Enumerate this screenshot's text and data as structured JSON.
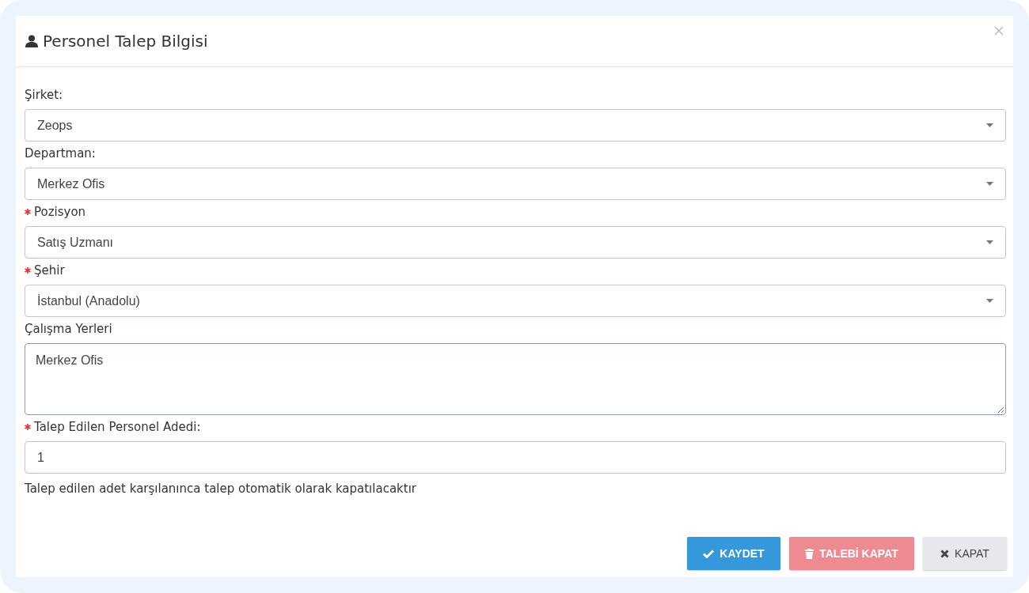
{
  "dialog": {
    "title": "Personel Talep Bilgisi"
  },
  "fields": [
    {
      "kind": "select",
      "label": "Şirket:",
      "required": false,
      "value": "Zeops"
    },
    {
      "kind": "select",
      "label": "Departman:",
      "required": false,
      "value": "Merkez Ofis"
    },
    {
      "kind": "select",
      "label": "Pozisyon",
      "required": true,
      "value": "Satış Uzmanı"
    },
    {
      "kind": "select",
      "label": "Şehir",
      "required": true,
      "value": "İstanbul (Anadolu)"
    },
    {
      "kind": "textarea",
      "label": "Çalışma Yerleri",
      "required": false,
      "value": "Merkez Ofis"
    },
    {
      "kind": "input",
      "label": "Talep Edilen Personel Adedi:",
      "required": true,
      "value": "1"
    }
  ],
  "note": "Talep edilen adet karşılanınca talep otomatik olarak kapatılacaktır",
  "buttons": [
    {
      "kind": "save",
      "label": "KAYDET"
    },
    {
      "kind": "delete",
      "label": "TALEBİ KAPAT"
    },
    {
      "kind": "close",
      "label": "KAPAT"
    }
  ]
}
